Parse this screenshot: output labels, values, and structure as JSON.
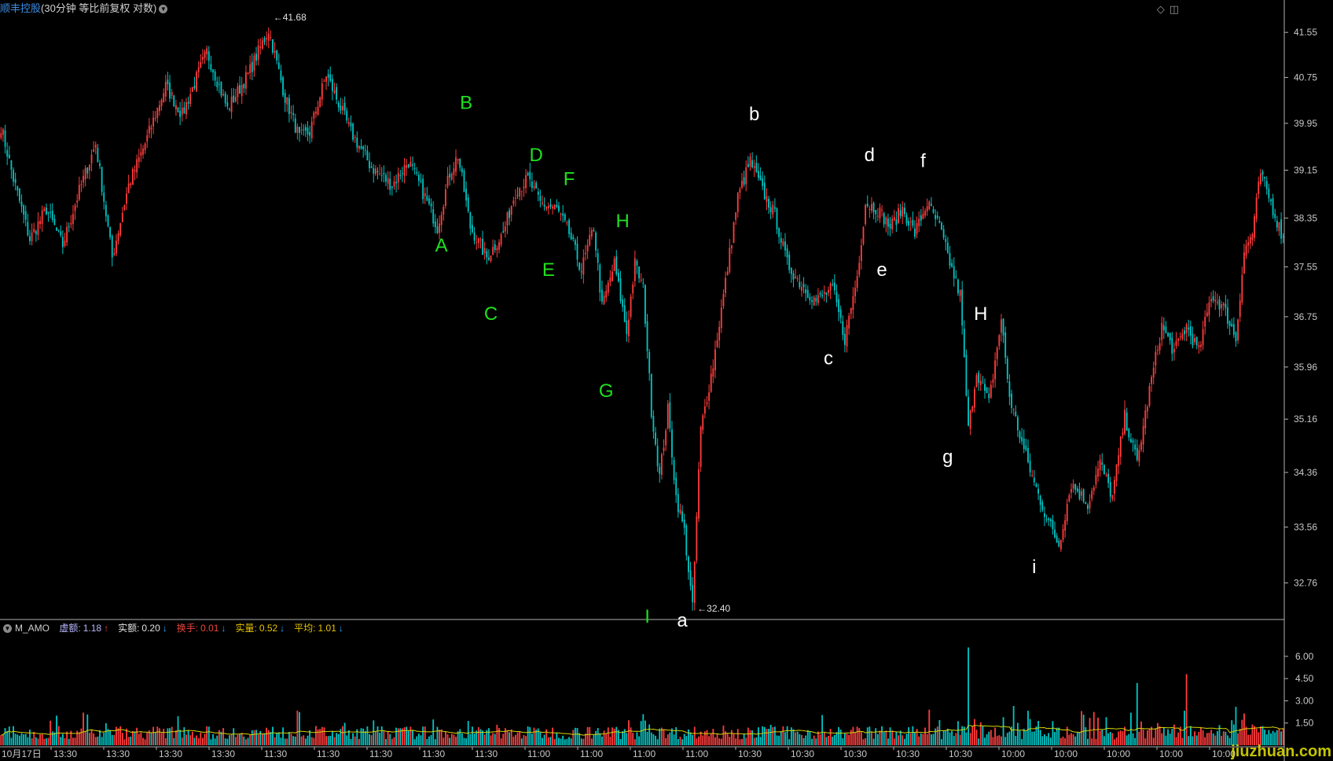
{
  "header": {
    "stock_name": "顺丰控股",
    "period_info": "(30分钟 等比前复权 对数)"
  },
  "top_right_icons": [
    "diamond-icon",
    "square-icon"
  ],
  "indicator": {
    "name": "M_AMO",
    "items": [
      {
        "label": "虚额:",
        "value": "1.18",
        "arrow": "↑",
        "color": "#b8b8ff"
      },
      {
        "label": "实额:",
        "value": "0.20",
        "arrow": "↓",
        "color": "#e0e0e0"
      },
      {
        "label": "换手:",
        "value": "0.01",
        "arrow": "↓",
        "color": "#e8453c"
      },
      {
        "label": "实量:",
        "value": "0.52",
        "arrow": "↓",
        "color": "#e6c200"
      },
      {
        "label": "平均:",
        "value": "1.01",
        "arrow": "↓",
        "color": "#e6c200"
      }
    ]
  },
  "watermark": "jiuzhuan.com",
  "chart_data": {
    "type": "candlestick",
    "scale": "log",
    "price_axis": {
      "ticks": [
        "41.55",
        "40.75",
        "39.95",
        "39.15",
        "38.35",
        "37.55",
        "36.75",
        "35.96",
        "35.16",
        "34.36",
        "33.56",
        "32.76"
      ],
      "ylim": [
        32.4,
        41.68
      ]
    },
    "volume_axis": {
      "ticks": [
        "6.00",
        "4.50",
        "3.00",
        "1.50"
      ],
      "ylim": [
        0,
        7
      ]
    },
    "x_axis": {
      "labels": [
        "10月17日",
        "13:30",
        "13:30",
        "13:30",
        "13:30",
        "11:30",
        "11:30",
        "11:30",
        "11:30",
        "11:30",
        "11:00",
        "11:00",
        "11:00",
        "11:00",
        "10:30",
        "10:30",
        "10:30",
        "10:30",
        "10:30",
        "10:00",
        "10:00",
        "10:00",
        "10:00",
        "10:00"
      ]
    },
    "extremes": {
      "high": {
        "label": "41.68",
        "value": 41.68
      },
      "low": {
        "label": "32.40",
        "value": 32.4
      }
    },
    "price_path": [
      [
        0,
        39.9
      ],
      [
        6,
        39.0
      ],
      [
        14,
        38.0
      ],
      [
        22,
        38.5
      ],
      [
        30,
        37.9
      ],
      [
        38,
        38.8
      ],
      [
        46,
        39.6
      ],
      [
        54,
        37.7
      ],
      [
        62,
        38.9
      ],
      [
        70,
        39.6
      ],
      [
        80,
        40.6
      ],
      [
        88,
        40.1
      ],
      [
        100,
        41.2
      ],
      [
        110,
        40.2
      ],
      [
        120,
        40.8
      ],
      [
        130,
        41.6
      ],
      [
        138,
        40.4
      ],
      [
        145,
        39.7
      ],
      [
        150,
        39.8
      ],
      [
        158,
        40.8
      ],
      [
        164,
        40.3
      ],
      [
        170,
        39.8
      ],
      [
        180,
        39.2
      ],
      [
        190,
        38.9
      ],
      [
        198,
        39.3
      ],
      [
        206,
        38.7
      ],
      [
        212,
        38.2
      ],
      [
        218,
        39.1
      ],
      [
        222,
        39.4
      ],
      [
        228,
        38.2
      ],
      [
        236,
        37.7
      ],
      [
        244,
        38.1
      ],
      [
        250,
        38.8
      ],
      [
        256,
        39.0
      ],
      [
        262,
        38.6
      ],
      [
        270,
        38.5
      ],
      [
        276,
        38.1
      ],
      [
        282,
        37.5
      ],
      [
        288,
        38.2
      ],
      [
        292,
        36.9
      ],
      [
        298,
        37.6
      ],
      [
        304,
        36.5
      ],
      [
        308,
        37.6
      ],
      [
        312,
        37.2
      ],
      [
        316,
        35.3
      ],
      [
        320,
        34.3
      ],
      [
        324,
        35.3
      ],
      [
        328,
        34.0
      ],
      [
        332,
        33.5
      ],
      [
        336,
        32.4
      ],
      [
        340,
        35.0
      ],
      [
        346,
        36.0
      ],
      [
        352,
        37.3
      ],
      [
        358,
        38.7
      ],
      [
        364,
        39.3
      ],
      [
        370,
        38.8
      ],
      [
        376,
        38.4
      ],
      [
        382,
        37.6
      ],
      [
        388,
        37.3
      ],
      [
        396,
        37.0
      ],
      [
        404,
        37.2
      ],
      [
        410,
        36.4
      ],
      [
        416,
        37.4
      ],
      [
        420,
        38.6
      ],
      [
        426,
        38.5
      ],
      [
        432,
        38.2
      ],
      [
        438,
        38.5
      ],
      [
        444,
        38.1
      ],
      [
        450,
        38.6
      ],
      [
        456,
        38.2
      ],
      [
        462,
        37.5
      ],
      [
        466,
        37.1
      ],
      [
        470,
        35.0
      ],
      [
        474,
        35.9
      ],
      [
        480,
        35.4
      ],
      [
        486,
        36.7
      ],
      [
        490,
        35.5
      ],
      [
        496,
        34.8
      ],
      [
        502,
        34.2
      ],
      [
        508,
        33.7
      ],
      [
        514,
        33.3
      ],
      [
        520,
        34.2
      ],
      [
        528,
        33.9
      ],
      [
        534,
        34.5
      ],
      [
        540,
        34.0
      ],
      [
        546,
        35.2
      ],
      [
        552,
        34.5
      ],
      [
        558,
        35.6
      ],
      [
        564,
        36.6
      ],
      [
        570,
        36.2
      ],
      [
        576,
        36.6
      ],
      [
        582,
        36.2
      ],
      [
        588,
        37.1
      ],
      [
        594,
        36.9
      ],
      [
        600,
        36.4
      ],
      [
        604,
        37.8
      ],
      [
        608,
        38.1
      ],
      [
        612,
        39.1
      ],
      [
        618,
        38.5
      ],
      [
        622,
        38.1
      ]
    ],
    "volume_spikes": [
      [
        470,
        6.6
      ],
      [
        552,
        4.2
      ],
      [
        576,
        4.8
      ],
      [
        312,
        2.1
      ],
      [
        40,
        2.2
      ],
      [
        600,
        2.6
      ]
    ],
    "annotations": [
      {
        "text": "A",
        "color": "green",
        "bar": 214,
        "price": 37.8
      },
      {
        "text": "B",
        "color": "green",
        "bar": 226,
        "price": 40.2
      },
      {
        "text": "C",
        "color": "green",
        "bar": 238,
        "price": 36.7
      },
      {
        "text": "D",
        "color": "green",
        "bar": 260,
        "price": 39.3
      },
      {
        "text": "E",
        "color": "green",
        "bar": 266,
        "price": 37.4
      },
      {
        "text": "F",
        "color": "green",
        "bar": 276,
        "price": 38.9
      },
      {
        "text": "G",
        "color": "green",
        "bar": 294,
        "price": 35.5
      },
      {
        "text": "H",
        "color": "green",
        "bar": 302,
        "price": 38.2
      },
      {
        "text": "I",
        "color": "green",
        "bar": 314,
        "price": 32.2
      },
      {
        "text": "a",
        "color": "white",
        "bar": 331,
        "price": 32.15
      },
      {
        "text": "b",
        "color": "white",
        "bar": 366,
        "price": 40.0
      },
      {
        "text": "c",
        "color": "white",
        "bar": 402,
        "price": 36.0
      },
      {
        "text": "d",
        "color": "white",
        "bar": 422,
        "price": 39.3
      },
      {
        "text": "e",
        "color": "white",
        "bar": 428,
        "price": 37.4
      },
      {
        "text": "f",
        "color": "white",
        "bar": 448,
        "price": 39.2
      },
      {
        "text": "g",
        "color": "white",
        "bar": 460,
        "price": 34.5
      },
      {
        "text": "H",
        "color": "white",
        "bar": 476,
        "price": 36.7
      },
      {
        "text": "i",
        "color": "white",
        "bar": 502,
        "price": 32.9
      }
    ],
    "colors": {
      "up": "#ff3c3c",
      "down": "#00c4c4",
      "volume_avg": "#d6d600",
      "annotation_green": "#1fe01f",
      "annotation_white": "#ffffff",
      "axis_text": "#c8c8c8",
      "grid_line": "#b0b0b0"
    }
  }
}
